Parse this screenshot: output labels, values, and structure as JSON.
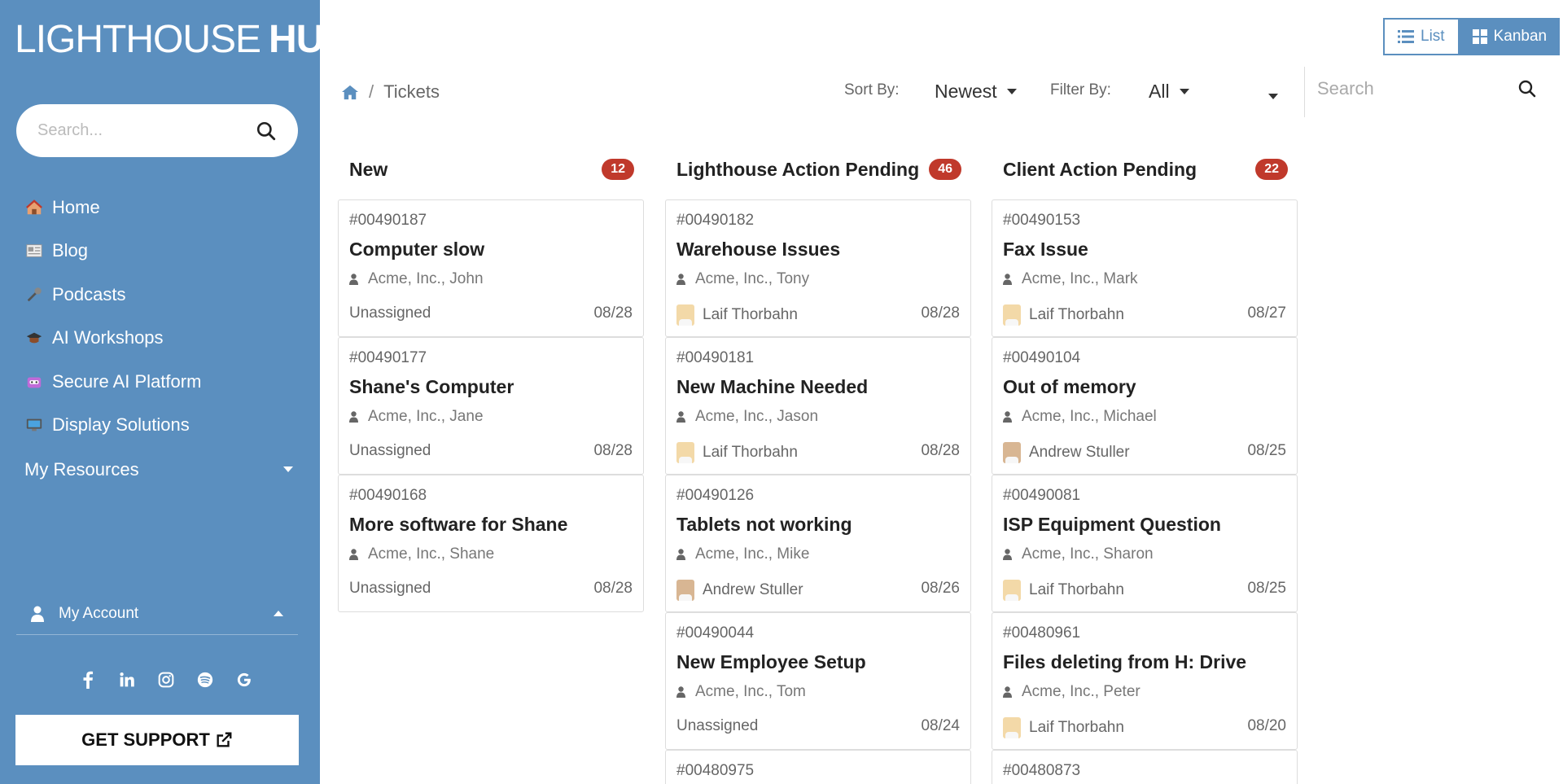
{
  "sidebar": {
    "logo_light": "LIGHTHOUSE",
    "logo_bold": "HUB",
    "search_placeholder": "Search...",
    "nav": [
      {
        "label": "Home",
        "icon": "house-icon"
      },
      {
        "label": "Blog",
        "icon": "newspaper-icon"
      },
      {
        "label": "Podcasts",
        "icon": "microphone-icon"
      },
      {
        "label": "AI Workshops",
        "icon": "graduation-cap-icon"
      },
      {
        "label": "Secure AI Platform",
        "icon": "robot-icon"
      },
      {
        "label": "Display Solutions",
        "icon": "monitor-icon"
      }
    ],
    "resources_label": "My Resources",
    "account_label": "My Account",
    "social": [
      "facebook-icon",
      "linkedin-icon",
      "instagram-icon",
      "spotify-icon",
      "google-icon"
    ],
    "support_label": "GET SUPPORT"
  },
  "view_toggle": {
    "list": "List",
    "kanban": "Kanban"
  },
  "breadcrumb": {
    "current": "Tickets"
  },
  "filters": {
    "sort_label": "Sort By:",
    "sort_value": "Newest",
    "filter_label": "Filter By:",
    "filter_value": "All"
  },
  "search": {
    "placeholder": "Search"
  },
  "colors": {
    "brand": "#5b8fbf",
    "badge": "#c0392b"
  },
  "columns": [
    {
      "title": "New",
      "count": "12",
      "cards": [
        {
          "num": "#00490187",
          "title": "Computer slow",
          "client": "Acme, Inc., John",
          "assignee": "Unassigned",
          "date": "08/28"
        },
        {
          "num": "#00490177",
          "title": "Shane's Computer",
          "client": "Acme, Inc., Jane",
          "assignee": "Unassigned",
          "date": "08/28"
        },
        {
          "num": "#00490168",
          "title": "More software for Shane",
          "client": "Acme, Inc., Shane",
          "assignee": "Unassigned",
          "date": "08/28"
        }
      ]
    },
    {
      "title": "Lighthouse Action Pending",
      "count": "46",
      "cards": [
        {
          "num": "#00490182",
          "title": "Warehouse Issues",
          "client": "Acme, Inc., Tony",
          "assignee": "Laif Thorbahn",
          "date": "08/28"
        },
        {
          "num": "#00490181",
          "title": "New Machine Needed",
          "client": "Acme, Inc., Jason",
          "assignee": "Laif Thorbahn",
          "date": "08/28"
        },
        {
          "num": "#00490126",
          "title": "Tablets not working",
          "client": "Acme, Inc., Mike",
          "assignee": "Andrew Stuller",
          "date": "08/26"
        },
        {
          "num": "#00490044",
          "title": "New Employee Setup",
          "client": "Acme, Inc., Tom",
          "assignee": "Unassigned",
          "date": "08/24"
        },
        {
          "num": "#00480975"
        }
      ]
    },
    {
      "title": "Client Action Pending",
      "count": "22",
      "cards": [
        {
          "num": "#00490153",
          "title": "Fax Issue",
          "client": "Acme, Inc., Mark",
          "assignee": "Laif Thorbahn",
          "date": "08/27"
        },
        {
          "num": "#00490104",
          "title": "Out of memory",
          "client": "Acme, Inc., Michael",
          "assignee": "Andrew Stuller",
          "date": "08/25"
        },
        {
          "num": "#00490081",
          "title": "ISP Equipment Question",
          "client": "Acme, Inc., Sharon",
          "assignee": "Laif Thorbahn",
          "date": "08/25"
        },
        {
          "num": "#00480961",
          "title": "Files deleting from H: Drive",
          "client": "Acme, Inc., Peter",
          "assignee": "Laif Thorbahn",
          "date": "08/20"
        },
        {
          "num": "#00480873"
        }
      ]
    }
  ]
}
